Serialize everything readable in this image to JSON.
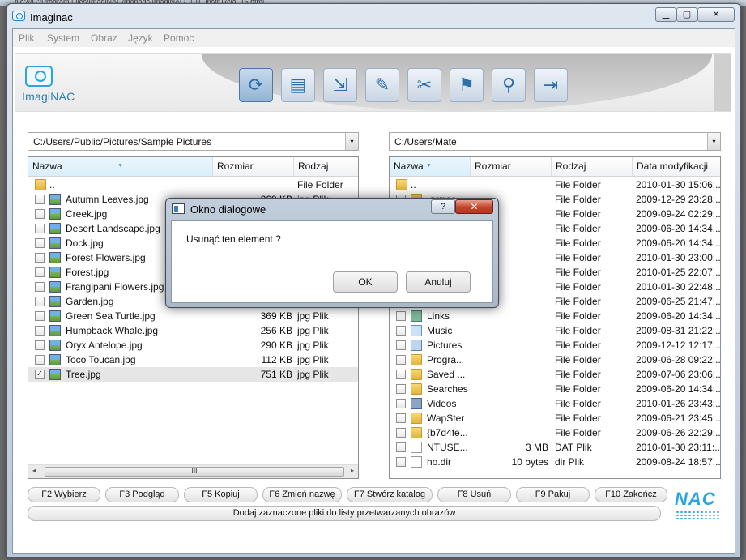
{
  "browser": {
    "url_text": "file:///C:/Program Files/ImagiNAC/mohadc/ImagiNAC_101_instrukcja_16.html"
  },
  "window": {
    "title": "Imaginac",
    "min": "▁",
    "max": "▢",
    "close": "✕"
  },
  "menu": [
    "Plik",
    "System",
    "Obraz",
    "Język",
    "Pomoc"
  ],
  "logo": {
    "text": "ImagiNAC"
  },
  "toolbar": {
    "icons": [
      "refresh-icon",
      "list-icon",
      "resize-icon",
      "paint-icon",
      "crop-icon",
      "bookmark-icon",
      "magnifier-icon",
      "exit-icon"
    ],
    "glyphs": [
      "⟳",
      "▤",
      "⇲",
      "✎",
      "✂",
      "⚑",
      "⚲",
      "⇥"
    ]
  },
  "left_panel": {
    "path": "C:/Users/Public/Pictures/Sample Pictures",
    "columns": [
      "Nazwa",
      "Rozmiar",
      "Rodzaj"
    ],
    "rows": [
      {
        "icon": "folder",
        "name": "..",
        "size": "",
        "type": "File Folder",
        "check": false,
        "hascb": false
      },
      {
        "icon": "img",
        "name": "Autumn Leaves.jpg",
        "size": "269 KB",
        "type": "jpg Plik",
        "check": false,
        "hascb": true
      },
      {
        "icon": "img",
        "name": "Creek.jpg",
        "size": "",
        "type": "",
        "check": false,
        "hascb": true
      },
      {
        "icon": "img",
        "name": "Desert Landscape.jpg",
        "size": "",
        "type": "",
        "check": false,
        "hascb": true
      },
      {
        "icon": "img",
        "name": "Dock.jpg",
        "size": "",
        "type": "",
        "check": false,
        "hascb": true
      },
      {
        "icon": "img",
        "name": "Forest Flowers.jpg",
        "size": "",
        "type": "",
        "check": false,
        "hascb": true
      },
      {
        "icon": "img",
        "name": "Forest.jpg",
        "size": "",
        "type": "",
        "check": false,
        "hascb": true
      },
      {
        "icon": "img",
        "name": "Frangipani Flowers.jpg",
        "size": "",
        "type": "",
        "check": false,
        "hascb": true
      },
      {
        "icon": "img",
        "name": "Garden.jpg",
        "size": "",
        "type": "",
        "check": false,
        "hascb": true
      },
      {
        "icon": "img",
        "name": "Green Sea Turtle.jpg",
        "size": "369 KB",
        "type": "jpg Plik",
        "check": false,
        "hascb": true
      },
      {
        "icon": "img",
        "name": "Humpback Whale.jpg",
        "size": "256 KB",
        "type": "jpg Plik",
        "check": false,
        "hascb": true
      },
      {
        "icon": "img",
        "name": "Oryx Antelope.jpg",
        "size": "290 KB",
        "type": "jpg Plik",
        "check": false,
        "hascb": true
      },
      {
        "icon": "img",
        "name": "Toco Toucan.jpg",
        "size": "112 KB",
        "type": "jpg Plik",
        "check": false,
        "hascb": true
      },
      {
        "icon": "img",
        "name": "Tree.jpg",
        "size": "751 KB",
        "type": "jpg Plik",
        "check": true,
        "hascb": true,
        "selected": true
      }
    ],
    "scroll_grip": "III",
    "left_arrow": "◂",
    "right_arrow": "▸"
  },
  "right_panel": {
    "path": "C:/Users/Mate",
    "columns": [
      "Nazwa",
      "Rozmiar",
      "Rodzaj",
      "Data modyfikacji"
    ],
    "rows": [
      {
        "icon": "folder",
        "name": "..",
        "size": "",
        "type": "File Folder",
        "date": "2010-01-30 15:06:...",
        "check": false,
        "hascb": false
      },
      {
        "icon": "folder",
        "name": ".gstrea...",
        "size": "",
        "type": "File Folder",
        "date": "2009-12-29 23:28:...",
        "check": false,
        "hascb": true
      },
      {
        "icon": "folder",
        "name": "",
        "size": "",
        "type": "File Folder",
        "date": "2009-09-24 02:29:...",
        "check": false,
        "hascb": true
      },
      {
        "icon": "folder",
        "name": "",
        "size": "",
        "type": "File Folder",
        "date": "2009-06-20 14:34:...",
        "check": false,
        "hascb": true
      },
      {
        "icon": "folder",
        "name": "",
        "size": "",
        "type": "File Folder",
        "date": "2009-06-20 14:34:...",
        "check": false,
        "hascb": true
      },
      {
        "icon": "folder",
        "name": "",
        "size": "",
        "type": "File Folder",
        "date": "2010-01-30 23:00:...",
        "check": false,
        "hascb": true
      },
      {
        "icon": "folder",
        "name": "",
        "size": "",
        "type": "File Folder",
        "date": "2010-01-25 22:07:...",
        "check": false,
        "hascb": true
      },
      {
        "icon": "folder",
        "name": "",
        "size": "",
        "type": "File Folder",
        "date": "2010-01-30 22:48:...",
        "check": false,
        "hascb": true
      },
      {
        "icon": "folder",
        "name": "",
        "size": "",
        "type": "File Folder",
        "date": "2009-06-25 21:47:...",
        "check": false,
        "hascb": true
      },
      {
        "icon": "link",
        "name": "Links",
        "size": "",
        "type": "File Folder",
        "date": "2009-06-20 14:34:...",
        "check": false,
        "hascb": true
      },
      {
        "icon": "music",
        "name": "Music",
        "size": "",
        "type": "File Folder",
        "date": "2009-08-31 21:22:...",
        "check": false,
        "hascb": true
      },
      {
        "icon": "pic",
        "name": "Pictures",
        "size": "",
        "type": "File Folder",
        "date": "2009-12-12 12:17:...",
        "check": false,
        "hascb": true
      },
      {
        "icon": "folder",
        "name": "Progra...",
        "size": "",
        "type": "File Folder",
        "date": "2009-06-28 09:22:...",
        "check": false,
        "hascb": true
      },
      {
        "icon": "folder",
        "name": "Saved ...",
        "size": "",
        "type": "File Folder",
        "date": "2009-07-06 23:06:...",
        "check": false,
        "hascb": true
      },
      {
        "icon": "folder",
        "name": "Searches",
        "size": "",
        "type": "File Folder",
        "date": "2009-06-20 14:34:...",
        "check": false,
        "hascb": true
      },
      {
        "icon": "vid",
        "name": "Videos",
        "size": "",
        "type": "File Folder",
        "date": "2010-01-26 23:43:...",
        "check": false,
        "hascb": true
      },
      {
        "icon": "folder",
        "name": "WapSter",
        "size": "",
        "type": "File Folder",
        "date": "2009-06-21 23:45:...",
        "check": false,
        "hascb": true
      },
      {
        "icon": "folder",
        "name": "{b7d4fe...",
        "size": "",
        "type": "File Folder",
        "date": "2009-06-26 22:29:...",
        "check": false,
        "hascb": true
      },
      {
        "icon": "file",
        "name": "NTUSE...",
        "size": "3 MB",
        "type": "DAT Plik",
        "date": "2010-01-30 23:11:...",
        "check": false,
        "hascb": true
      },
      {
        "icon": "file",
        "name": "ho.dir",
        "size": "10 bytes",
        "type": "dir Plik",
        "date": "2009-08-24 18:57:...",
        "check": false,
        "hascb": true
      }
    ]
  },
  "function_keys": [
    "F2 Wybierz",
    "F3 Podgląd",
    "F5 Kopiuj",
    "F6 Zmień nazwę",
    "F7 Stwórz katalog",
    "F8 Usuń",
    "F9 Pakuj",
    "F10 Zakończ"
  ],
  "add_bar": "Dodaj zaznaczone pliki do listy przetwarzanych obrazów",
  "nac_logo": "NAC",
  "dialog": {
    "title": "Okno dialogowe",
    "help": "?",
    "close": "✕",
    "message": "Usunąć ten element ?",
    "ok": "OK",
    "cancel": "Anuluj"
  }
}
